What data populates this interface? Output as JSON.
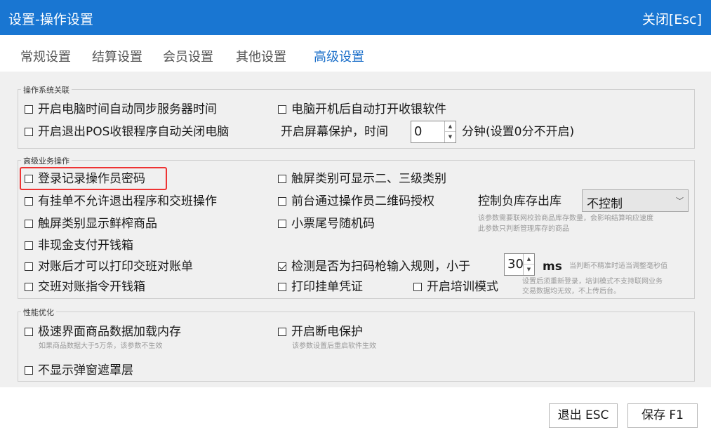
{
  "window": {
    "title": "设置-操作设置",
    "close_label": "关闭[Esc]",
    "accent": "#1976d2"
  },
  "tabs": [
    {
      "label": "常规设置"
    },
    {
      "label": "结算设置"
    },
    {
      "label": "会员设置"
    },
    {
      "label": "其他设置"
    },
    {
      "label": "高级设置",
      "active": true
    }
  ],
  "groups": {
    "os": {
      "label": "操作系统关联",
      "sync_time": {
        "label": "开启电脑时间自动同步服务器时间",
        "checked": false
      },
      "autostart": {
        "label": "电脑开机后自动打开收银软件",
        "checked": false
      },
      "shutdown": {
        "label": "开启退出POS收银程序自动关闭电脑",
        "checked": false
      },
      "screensaver_label": "开启屏幕保护，时间",
      "screensaver_value": "0",
      "screensaver_suffix": "分钟(设置0分不开启)"
    },
    "advanced": {
      "label": "高级业务操作",
      "login_password": {
        "label": "登录记录操作员密码",
        "checked": false
      },
      "touch_category": {
        "label": "触屏类别可显示二、三级类别",
        "checked": false
      },
      "pending_no_exit": {
        "label": "有挂单不允许退出程序和交班操作",
        "checked": false
      },
      "qr_auth": {
        "label": "前台通过操作员二维码授权",
        "checked": false
      },
      "stock_label": "控制负库存出库",
      "stock_value": "不控制",
      "stock_hint1": "该参数需要联网校验商品库存数量，会影响结算响应速度",
      "stock_hint2": "此参数只判断管理库存的商品",
      "fresh_goods": {
        "label": "触屏类别显示鲜榨商品",
        "checked": false
      },
      "receipt_random": {
        "label": "小票尾号随机码",
        "checked": false
      },
      "noncash_drawer": {
        "label": "非现金支付开钱箱",
        "checked": false
      },
      "print_after_reconcile": {
        "label": "对账后才可以打印交班对账单",
        "checked": false
      },
      "scanner_rule": {
        "label": "检测是否为扫码枪输入规则，小于",
        "checked": true
      },
      "scanner_value": "30",
      "scanner_unit": "ms",
      "scanner_hint": "当判断不精准时适当调整毫秒值",
      "handover_drawer": {
        "label": "交班对账指令开钱箱",
        "checked": false
      },
      "print_pending": {
        "label": "打印挂单凭证",
        "checked": false
      },
      "training_mode": {
        "label": "开启培训模式",
        "checked": false
      },
      "training_hint1": "设置后须重新登录，培训模式不支持联网业务",
      "training_hint2": "交易数据均无效，不上传后台。"
    },
    "perf": {
      "label": "性能优化",
      "fast_load": {
        "label": "极速界面商品数据加载内存",
        "checked": false
      },
      "fast_load_hint": "如果商品数据大于5万条，该参数不生效",
      "power_protect": {
        "label": "开启断电保护",
        "checked": false
      },
      "power_protect_hint": "该参数设置后重启软件生效",
      "no_mask": {
        "label": "不显示弹窗遮罩层",
        "checked": false
      }
    }
  },
  "footer": {
    "exit_label": "退出 ESC",
    "save_label": "保存 F1"
  }
}
